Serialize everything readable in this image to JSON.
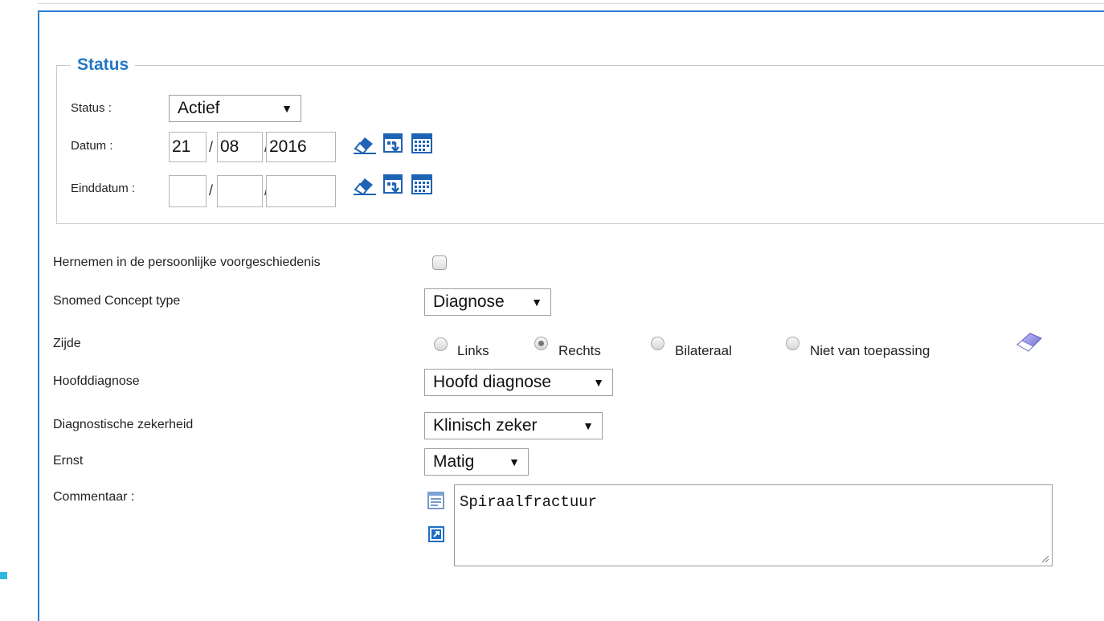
{
  "status_section": {
    "legend": "Status",
    "status_label": "Status :",
    "status_value": "Actief",
    "datum_label": "Datum :",
    "datum_day": "21",
    "datum_month": "08",
    "datum_year": "2016",
    "einddatum_label": "Einddatum :",
    "einddatum_day": "",
    "einddatum_month": "",
    "einddatum_year": "",
    "slash": "/"
  },
  "form": {
    "hernemen_label": "Hernemen in de persoonlijke voorgeschiedenis",
    "hernemen_checked": false,
    "snomed_label": "Snomed Concept type",
    "snomed_value": "Diagnose",
    "zijde_label": "Zijde",
    "zijde_options": [
      "Links",
      "Rechts",
      "Bilateraal",
      "Niet van toepassing"
    ],
    "zijde_selected": "Rechts",
    "hoofddiagnose_label": "Hoofddiagnose",
    "hoofddiagnose_value": "Hoofd diagnose",
    "zekerheid_label": "Diagnostische zekerheid",
    "zekerheid_value": "Klinisch zeker",
    "ernst_label": "Ernst",
    "ernst_value": "Matig",
    "commentaar_label": "Commentaar :",
    "commentaar_value": "Spiraalfractuur"
  },
  "icons": {
    "eraser": "eraser-icon",
    "date_picker": "date-picker-icon",
    "calendar": "calendar-icon",
    "text_template": "text-template-icon",
    "expand": "expand-icon"
  },
  "colors": {
    "accent": "#2a7ed8",
    "legend": "#2378c6",
    "highlight": "#2fb7e0"
  }
}
